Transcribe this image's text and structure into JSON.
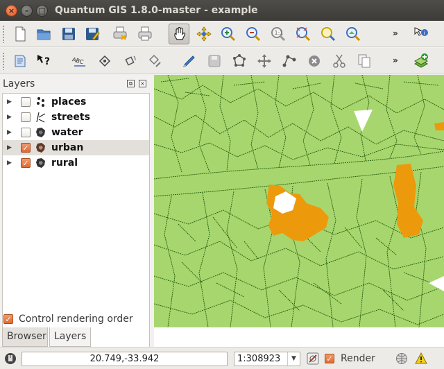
{
  "window": {
    "title": "Quantum GIS 1.8.0-master - example",
    "close_glyph": "×",
    "minimize_glyph": "–",
    "maximize_glyph": "□"
  },
  "toolbar1": {
    "icons": [
      "new-project-icon",
      "open-project-icon",
      "save-project-icon",
      "save-as-icon",
      "print-composer-icon",
      "composer-manager-icon",
      "pan-icon",
      "pan-to-selection-icon",
      "zoom-in-icon",
      "zoom-out-icon",
      "zoom-actual-icon",
      "zoom-full-icon",
      "zoom-selection-icon",
      "zoom-layer-icon",
      "identify-icon"
    ],
    "overflow_label": "»"
  },
  "toolbar2": {
    "icons": [
      "python-icon",
      "whats-this-icon",
      "label-tool-icon",
      "move-label-icon",
      "rotate-label-icon",
      "change-label-icon",
      "toggle-editing-icon",
      "save-edits-icon",
      "add-feature-icon",
      "move-feature-icon",
      "node-tool-icon",
      "delete-selected-icon",
      "cut-features-icon",
      "copy-features-icon",
      "add-layer-icon"
    ],
    "overflow_label": "»"
  },
  "layers_panel": {
    "title": "Layers",
    "float_glyph": "⧉",
    "close_glyph": "×",
    "layers": [
      {
        "name": "places",
        "checked": false,
        "icon": "point-layer-icon"
      },
      {
        "name": "streets",
        "checked": false,
        "icon": "line-layer-icon"
      },
      {
        "name": "water",
        "checked": false,
        "icon": "polygon-layer-icon"
      },
      {
        "name": "urban",
        "checked": true,
        "icon": "polygon-layer-icon"
      },
      {
        "name": "rural",
        "checked": true,
        "icon": "polygon-layer-icon"
      }
    ],
    "expander_glyph": "▶",
    "check_glyph": "✓",
    "control_rendering_order": {
      "label": "Control rendering order",
      "checked": true
    },
    "tabs": [
      "Browser",
      "Layers"
    ],
    "active_tab": "Layers"
  },
  "colors": {
    "rural_fill": "#a8d66e",
    "urban_fill": "#ec9a0c",
    "boundary_stroke": "#2b6412",
    "checkbox_accent": "#e06a33"
  },
  "statusbar": {
    "coordinates": "20.749,-33.942",
    "scale": "1:308923",
    "scale_arrow": "▼",
    "render_label": "Render",
    "render_checked": true
  }
}
